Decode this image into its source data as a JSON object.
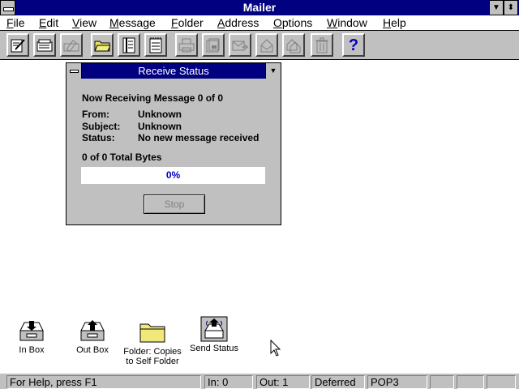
{
  "app": {
    "title": "Mailer"
  },
  "menu": [
    "File",
    "Edit",
    "View",
    "Message",
    "Folder",
    "Address",
    "Options",
    "Window",
    "Help"
  ],
  "toolbar": {
    "buttons": [
      {
        "icon": "compose-icon",
        "enabled": true
      },
      {
        "icon": "address-book-icon",
        "enabled": true
      },
      {
        "icon": "sign-icon",
        "enabled": false
      },
      {
        "icon": "open-folder-icon",
        "enabled": true
      },
      {
        "icon": "notebook-icon",
        "enabled": true
      },
      {
        "icon": "notepad-icon",
        "enabled": true
      },
      {
        "icon": "print-icon",
        "enabled": false
      },
      {
        "icon": "save-icon",
        "enabled": false
      },
      {
        "icon": "forward-icon",
        "enabled": false
      },
      {
        "icon": "reply-icon",
        "enabled": false
      },
      {
        "icon": "reply-all-icon",
        "enabled": false
      },
      {
        "icon": "trash-icon",
        "enabled": false
      },
      {
        "icon": "help-icon",
        "enabled": true
      }
    ]
  },
  "dialog": {
    "title": "Receive Status",
    "heading": "Now Receiving Message 0 of 0",
    "from_label": "From:",
    "from_value": "Unknown",
    "subject_label": "Subject:",
    "subject_value": "Unknown",
    "status_label": "Status:",
    "status_value": "No new message received",
    "bytes": "0 of 0 Total Bytes",
    "progress_text": "0%",
    "progress_value": 0,
    "stop_label": "Stop"
  },
  "desktop_icons": [
    {
      "line1": "In Box",
      "line2": "",
      "icon": "inbox-tray-icon"
    },
    {
      "line1": "Out Box",
      "line2": "",
      "icon": "outbox-tray-icon"
    },
    {
      "line1": "Folder: Copies",
      "line2": "to Self Folder",
      "icon": "folder-icon"
    },
    {
      "line1": "Send Status",
      "line2": "",
      "icon": "send-status-icon"
    }
  ],
  "statusbar": {
    "help": "For Help, press F1",
    "in": "In:  0",
    "out": "Out:  1",
    "mode": "Deferred",
    "protocol": "POP3"
  },
  "colors": {
    "titlebar": "#000080",
    "face": "#c0c0c0",
    "progress_text": "#0000c0"
  }
}
